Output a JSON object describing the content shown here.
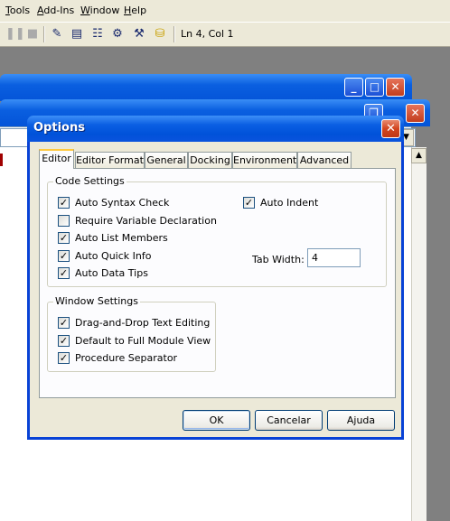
{
  "menu": [
    "Tools",
    "Add-Ins",
    "Window",
    "Help"
  ],
  "toolbar": {
    "icons": [
      "pause-icon",
      "stop-icon",
      "design-mode-icon",
      "project-explorer-icon",
      "properties-window-icon",
      "object-browser-icon",
      "toolbox-icon",
      "control-toolbox-icon"
    ],
    "position_text": "Ln 4, Col 1"
  },
  "dialog": {
    "title": "Options",
    "tabs": [
      "Editor",
      "Editor Format",
      "General",
      "Docking",
      "Environment",
      "Advanced"
    ],
    "active_tab": "Editor",
    "code_settings": {
      "label": "Code Settings",
      "options": [
        {
          "label": "Auto Syntax Check",
          "checked": true
        },
        {
          "label": "Require Variable Declaration",
          "checked": false
        },
        {
          "label": "Auto List Members",
          "checked": true
        },
        {
          "label": "Auto Quick Info",
          "checked": true
        },
        {
          "label": "Auto Data Tips",
          "checked": true
        }
      ],
      "auto_indent": {
        "label": "Auto Indent",
        "checked": true
      },
      "tab_width_label": "Tab Width:",
      "tab_width_value": "4"
    },
    "window_settings": {
      "label": "Window Settings",
      "options": [
        {
          "label": "Drag-and-Drop Text Editing",
          "checked": true
        },
        {
          "label": "Default to Full Module View",
          "checked": true
        },
        {
          "label": "Procedure Separator",
          "checked": true
        }
      ]
    },
    "buttons": {
      "ok": "OK",
      "cancel": "Cancelar",
      "help": "Ajuda"
    }
  },
  "colors": {
    "xp_title_blue": "#0a5fe0",
    "xp_close_red": "#c23d1e",
    "dialog_face": "#ece9d8",
    "tab_panel": "#fcfcfe",
    "active_tab_accent": "#ffc83c"
  }
}
